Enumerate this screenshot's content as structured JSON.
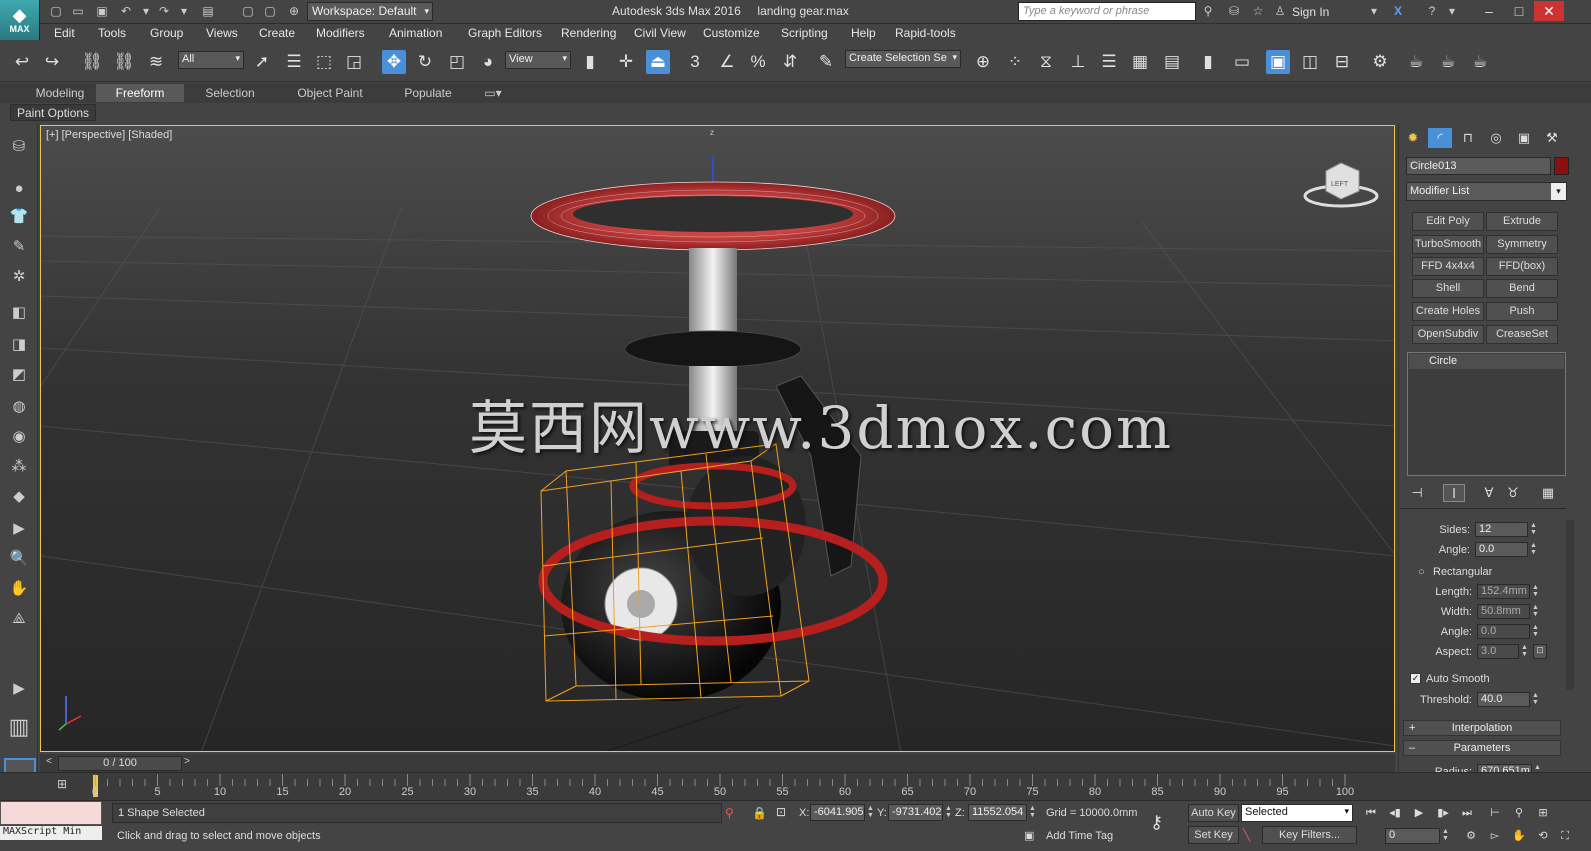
{
  "title": {
    "app_title": "Autodesk 3ds Max 2016     landing gear.max",
    "logo_text": "MAX",
    "workspace": "Workspace: Default",
    "search_placeholder": "Type a keyword or phrase",
    "sign_in": "Sign In"
  },
  "menu": [
    "Edit",
    "Tools",
    "Group",
    "Views",
    "Create",
    "Modifiers",
    "Animation",
    "Graph Editors",
    "Rendering",
    "Civil View",
    "Customize",
    "Scripting",
    "Help",
    "Rapid-tools"
  ],
  "toolbar": {
    "selection_filter": "All",
    "ref_coord": "View",
    "named_selection": "Create Selection Se",
    "snap_label": "3"
  },
  "ribbon": {
    "tabs": [
      "Modeling",
      "Freeform",
      "Selection",
      "Object Paint",
      "Populate"
    ],
    "active_tab": "Freeform",
    "sub_label": "Paint Options"
  },
  "viewport": {
    "label": "[+] [Perspective] [Shaded]",
    "viewcube_label": "LEFT",
    "axis_z": "z",
    "watermark": "莫西网www.3dmox.com",
    "accent_color": "#f0c34a"
  },
  "command_panel": {
    "object_name": "Circle013",
    "object_color": "#8b0f0f",
    "modifier_list": "Modifier List",
    "modifier_buttons": [
      [
        "Edit Poly",
        "Extrude"
      ],
      [
        "TurboSmooth",
        "Symmetry"
      ],
      [
        "FFD 4x4x4",
        "FFD(box)"
      ],
      [
        "Shell",
        "Bend"
      ],
      [
        "Create Holes",
        "Push"
      ],
      [
        "OpenSubdiv",
        "CreaseSet"
      ]
    ],
    "stack_item": "Circle",
    "params": {
      "sides_label": "Sides:",
      "sides_value": "12",
      "angle_label": "Angle:",
      "angle_value": "0.0",
      "rectangular_label": "Rectangular",
      "length_label": "Length:",
      "length_value": "152.4mm",
      "width_label": "Width:",
      "width_value": "50.8mm",
      "angle2_label": "Angle:",
      "angle2_value": "0.0",
      "aspect_label": "Aspect:",
      "aspect_value": "3.0",
      "auto_smooth_label": "Auto Smooth",
      "threshold_label": "Threshold:",
      "threshold_value": "40.0",
      "interpolation": "Interpolation",
      "parameters": "Parameters",
      "radius_label": "Radius:",
      "radius_value": "670.651m"
    }
  },
  "timeline": {
    "frame_range": "0 / 100",
    "ticks": [
      "0",
      "5",
      "10",
      "15",
      "20",
      "25",
      "30",
      "35",
      "40",
      "45",
      "50",
      "55",
      "60",
      "65",
      "70",
      "75",
      "80",
      "85",
      "90",
      "95",
      "100"
    ]
  },
  "status": {
    "maxscript": "MAXScript Min",
    "selection": "1 Shape Selected",
    "prompt": "Click and drag to select and move objects",
    "x_label": "X:",
    "x_value": "-6041.905",
    "y_label": "Y:",
    "y_value": "-9731.402",
    "z_label": "Z:",
    "z_value": "11552.054",
    "grid": "Grid = 10000.0mm",
    "add_time_tag": "Add Time Tag",
    "auto_key": "Auto Key",
    "set_key": "Set Key",
    "key_mode": "Selected",
    "key_filters": "Key Filters...",
    "frame_value": "0"
  }
}
